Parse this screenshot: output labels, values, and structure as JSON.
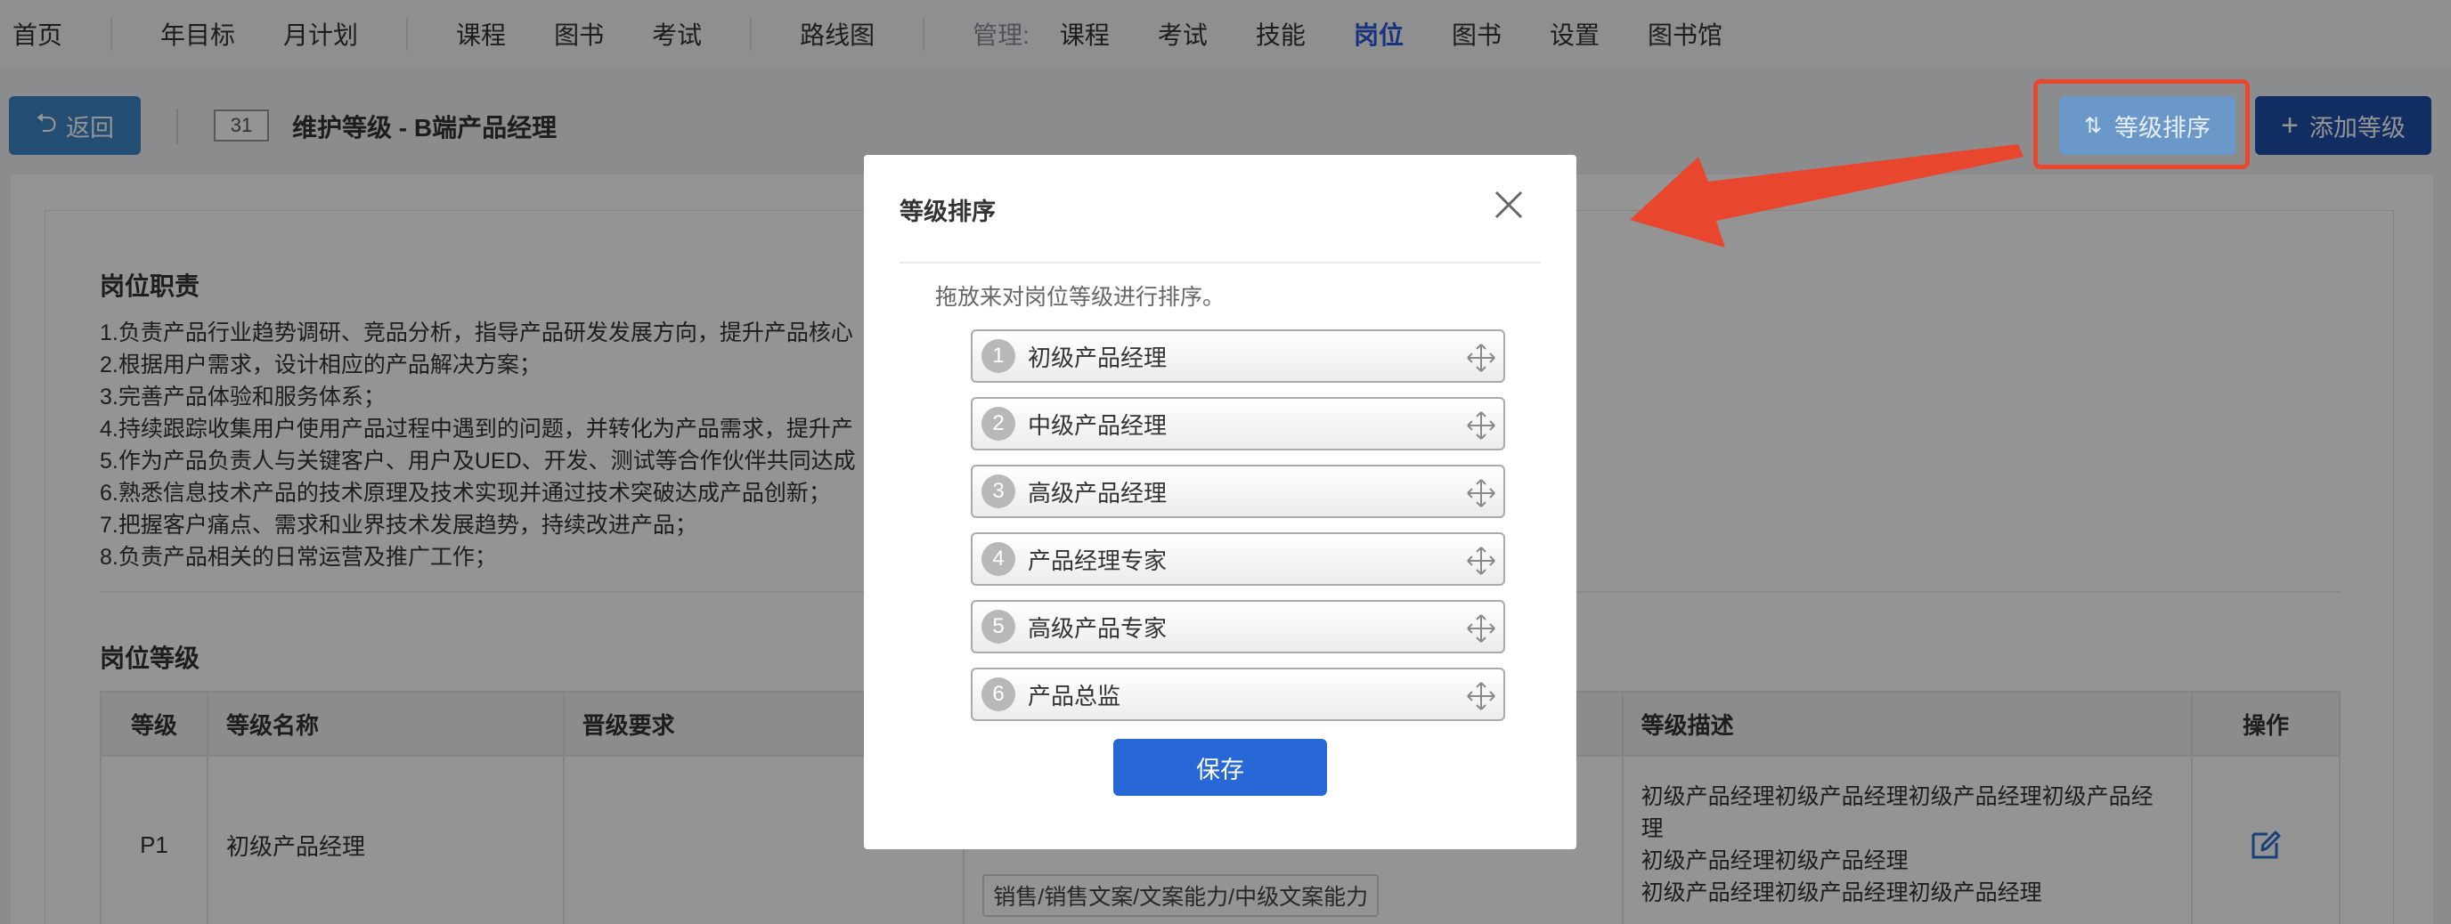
{
  "nav": {
    "items": [
      "首页",
      "年目标",
      "月计划",
      "课程",
      "图书",
      "考试",
      "路线图"
    ],
    "admin_label": "管理:",
    "admin_items": [
      "课程",
      "考试",
      "技能",
      "岗位",
      "图书",
      "设置",
      "图书馆"
    ],
    "active_admin": "岗位"
  },
  "toolbar": {
    "back_label": "返回",
    "level_count": "31",
    "title": "维护等级 - B端产品经理",
    "sort_label": "等级排序",
    "add_label": "添加等级"
  },
  "duties": {
    "title": "岗位职责",
    "items": [
      "1.负责产品行业趋势调研、竞品分析，指导产品研发发展方向，提升产品核心",
      "2.根据用户需求，设计相应的产品解决方案；",
      "3.完善产品体验和服务体系；",
      "4.持续跟踪收集用户使用产品过程中遇到的问题，并转化为产品需求，提升产",
      "5.作为产品负责人与关键客户、用户及UED、开发、测试等合作伙伴共同达成",
      "6.熟悉信息技术产品的技术原理及技术实现并通过技术突破达成产品创新；",
      "7.把握客户痛点、需求和业界技术发展趋势，持续改进产品；",
      "8.负责产品相关的日常运营及推广工作；"
    ]
  },
  "levels": {
    "title": "岗位等级",
    "headers": [
      "等级",
      "等级名称",
      "晋级要求",
      "",
      "等级描述",
      "操作"
    ],
    "rows": [
      {
        "level": "P1",
        "name": "初级产品经理",
        "requirement": "",
        "skills": [
          "销售/销售文案/文案能力/中级文案能力"
        ],
        "description": [
          "初级产品经理初级产品经理初级产品经理初级产品经",
          "理",
          "初级产品经理初级产品经理",
          "初级产品经理初级产品经理初级产品经理"
        ]
      }
    ]
  },
  "modal": {
    "title": "等级排序",
    "hint": "拖放来对岗位等级进行排序。",
    "items": [
      {
        "num": "1",
        "name": "初级产品经理"
      },
      {
        "num": "2",
        "name": "中级产品经理"
      },
      {
        "num": "3",
        "name": "高级产品经理"
      },
      {
        "num": "4",
        "name": "产品经理专家"
      },
      {
        "num": "5",
        "name": "高级产品专家"
      },
      {
        "num": "6",
        "name": "产品总监"
      }
    ],
    "save_label": "保存"
  },
  "colors": {
    "primary": "#2767d6",
    "active_nav": "#2a5bd7",
    "annotation_red": "#e8472e"
  }
}
